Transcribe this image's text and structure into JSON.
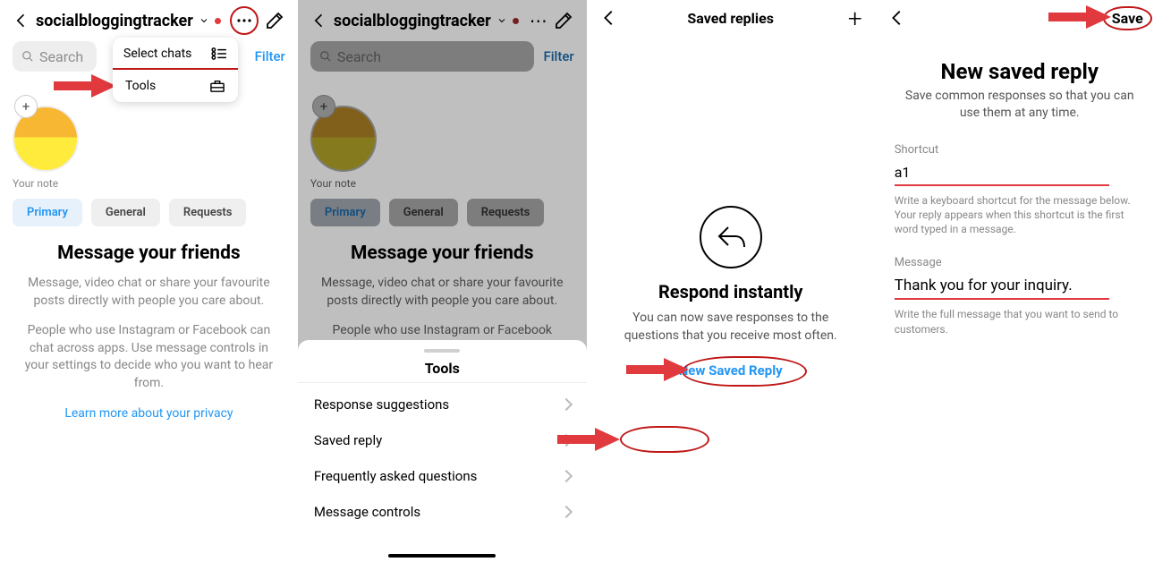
{
  "common": {
    "username": "socialbloggingtracker",
    "search_placeholder": "Search",
    "filter_label": "Filter",
    "note_label": "Your note",
    "tabs": {
      "primary": "Primary",
      "general": "General",
      "requests": "Requests"
    },
    "msg_heading": "Message your friends",
    "msg_p1": "Message, video chat or share your favourite posts directly with people you care about.",
    "msg_p2": "People who use Instagram or Facebook can chat across apps. Use message controls in your settings to decide who you want to hear from.",
    "msg_link": "Learn more about your privacy"
  },
  "panel1": {
    "menu": {
      "select_chats": "Select chats",
      "tools": "Tools"
    }
  },
  "panel2": {
    "sheet_title": "Tools",
    "rows": [
      "Response suggestions",
      "Saved reply",
      "Frequently asked questions",
      "Message controls"
    ]
  },
  "panel3": {
    "title": "Saved replies",
    "heading": "Respond instantly",
    "sub": "You can now save responses to the questions that you receive most often.",
    "cta": "New Saved Reply"
  },
  "panel4": {
    "save": "Save",
    "heading": "New saved reply",
    "sub": "Save common responses so that you can use them at any time.",
    "shortcut_lbl": "Shortcut",
    "shortcut_val": "a1",
    "shortcut_hint": "Write a keyboard shortcut for the message below. Your reply appears when this shortcut is the first word typed in a message.",
    "message_lbl": "Message",
    "message_val": "Thank you for your inquiry.",
    "message_hint": "Write the full message that you want to send to customers."
  }
}
